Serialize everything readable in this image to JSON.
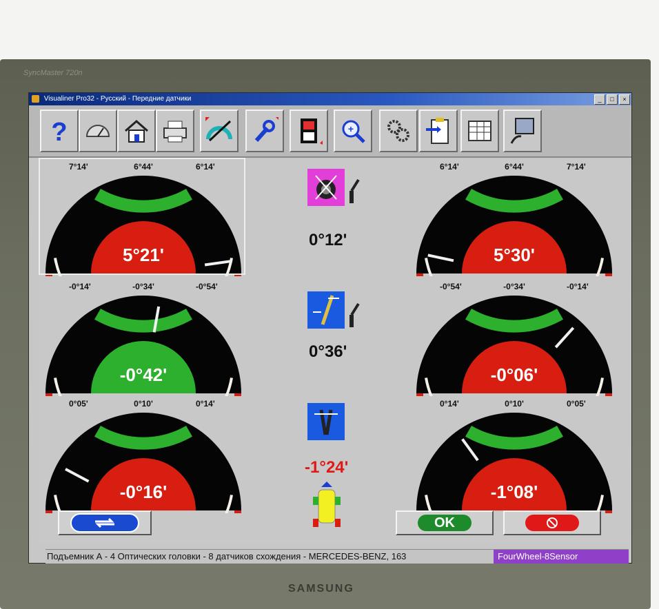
{
  "monitor": {
    "brand": "SyncMaster 720n",
    "logo": "SAMSUNG"
  },
  "window": {
    "title": "Visualiner Pro32 - Русский - Передние датчики",
    "buttons": [
      "_",
      "□",
      "×"
    ]
  },
  "toolbar": {
    "items": [
      {
        "name": "help-button",
        "icon": "question-icon"
      },
      {
        "name": "gauge-button",
        "icon": "speedometer-icon"
      },
      {
        "name": "home-button",
        "icon": "house-icon"
      },
      {
        "name": "print-button",
        "icon": "printer-icon"
      },
      {
        "name": "alignment-button",
        "icon": "protractor-icon"
      },
      {
        "name": "adjust-button",
        "icon": "wrench-icon"
      },
      {
        "name": "film-button",
        "icon": "film-icon"
      },
      {
        "name": "zoom-button",
        "icon": "magnifier-icon"
      },
      {
        "name": "settings-button",
        "icon": "gears-icon"
      },
      {
        "name": "clipboard-button",
        "icon": "clipboard-icon"
      },
      {
        "name": "report-button",
        "icon": "table-icon"
      },
      {
        "name": "monitor-button",
        "icon": "screen-icon"
      }
    ]
  },
  "gauges": [
    {
      "id": "camber-left",
      "left": "7°14'",
      "center": "6°44'",
      "right": "6°14'",
      "value": "5°21'",
      "status": "out-of-range",
      "selected": true
    },
    {
      "id": "camber-right",
      "left": "6°14'",
      "center": "6°44'",
      "right": "7°14'",
      "value": "5°30'",
      "status": "out-of-range",
      "selected": false
    },
    {
      "id": "caster-left",
      "left": "-0°14'",
      "center": "-0°34'",
      "right": "-0°54'",
      "value": "-0°42'",
      "status": "in-range",
      "selected": false
    },
    {
      "id": "caster-right",
      "left": "-0°54'",
      "center": "-0°34'",
      "right": "-0°14'",
      "value": "-0°06'",
      "status": "out-of-range",
      "selected": false
    },
    {
      "id": "toe-left",
      "left": "0°05'",
      "center": "0°10'",
      "right": "0°14'",
      "value": "-0°16'",
      "status": "out-of-range",
      "selected": false
    },
    {
      "id": "toe-right",
      "left": "0°14'",
      "center": "0°10'",
      "right": "0°05'",
      "value": "-1°08'",
      "status": "out-of-range",
      "selected": false
    }
  ],
  "middle": {
    "camber_cross": "0°12'",
    "caster_cross": "0°36'",
    "total_toe": "-1°24'"
  },
  "buttons": {
    "ok": "OK",
    "cancel_icon": "no-entry-icon",
    "swap_icon": "swap-arrows-icon"
  },
  "status": {
    "text": "Подъемник А - 4 Оптических головки - 8 датчиков схождения - MERCEDES-BENZ, 163",
    "mode": "FourWheel-8Sensor"
  },
  "colors": {
    "in_range": "#2db02d",
    "out_of_range": "#d81e10",
    "dial": "#050505",
    "accent_purple": "#9040c8"
  }
}
